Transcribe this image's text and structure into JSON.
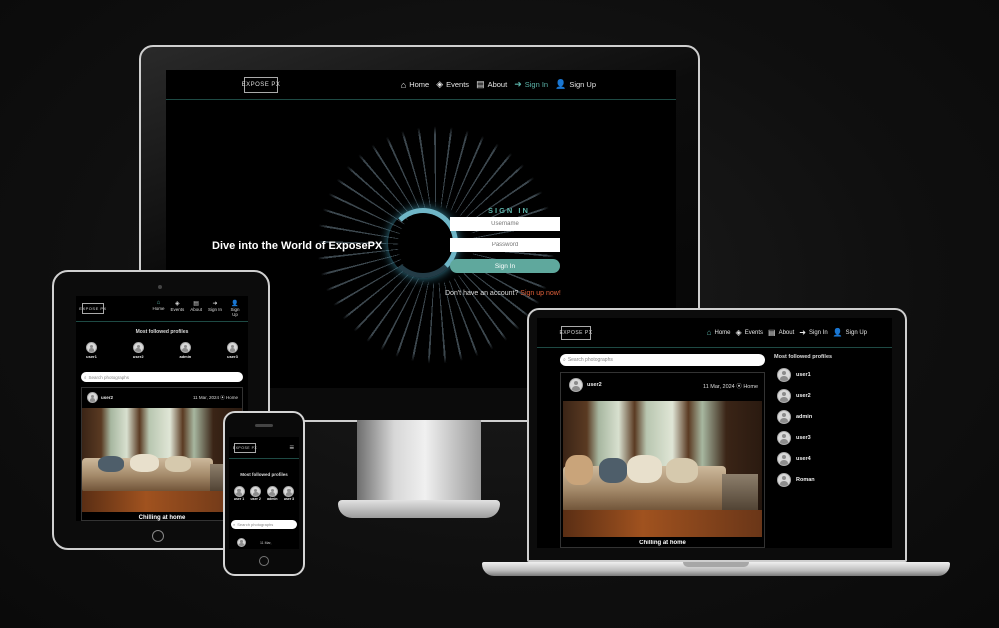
{
  "colors": {
    "accent": "#5bb3a9",
    "signup_link": "#e0603a",
    "background": "#0f0f0f"
  },
  "desktop": {
    "logo": "EXPOSE PX",
    "nav": [
      {
        "label": "Home",
        "icon": "home-icon"
      },
      {
        "label": "Events",
        "icon": "compass-icon"
      },
      {
        "label": "About",
        "icon": "book-icon"
      },
      {
        "label": "Sign In",
        "icon": "sign-in-icon"
      },
      {
        "label": "Sign Up",
        "icon": "user-plus-icon"
      }
    ],
    "hero_title": "Dive into the World of ExposePX",
    "signin": {
      "heading": "SIGN IN",
      "username_placeholder": "Username",
      "password_placeholder": "Password",
      "button": "Sign In",
      "no_account_text": "Don't have an account?",
      "signup_link": "Sign up now!"
    }
  },
  "tablet": {
    "logo": "EXPOSE PX",
    "nav": [
      {
        "label": "Home",
        "icon": "home-icon"
      },
      {
        "label": "Events",
        "icon": "compass-icon"
      },
      {
        "label": "About",
        "icon": "book-icon"
      },
      {
        "label": "Sign In",
        "icon": "sign-in-icon"
      },
      {
        "label": "Sign Up",
        "icon": "user-plus-icon"
      }
    ],
    "most_followed_heading": "Most followed profiles",
    "profiles": [
      "user1",
      "user2",
      "admin",
      "user3"
    ],
    "search_placeholder": "Search photographs",
    "post": {
      "user": "user2",
      "date": "11 Mar, 2024",
      "location": "Home",
      "caption": "Chilling at home"
    }
  },
  "phone": {
    "logo": "EXPOSE PX",
    "menu_icon": "hamburger-icon",
    "most_followed_heading": "Most followed profiles",
    "profiles": [
      "user 1",
      "user 2",
      "admin",
      "user 3"
    ],
    "search_placeholder": "Search photographs",
    "post": {
      "date": "11 Mar,"
    }
  },
  "laptop": {
    "logo": "EXPOSE PX",
    "nav": [
      {
        "label": "Home",
        "icon": "home-icon"
      },
      {
        "label": "Events",
        "icon": "compass-icon"
      },
      {
        "label": "About",
        "icon": "book-icon"
      },
      {
        "label": "Sign In",
        "icon": "sign-in-icon"
      },
      {
        "label": "Sign Up",
        "icon": "user-plus-icon"
      }
    ],
    "search_placeholder": "Search photographs",
    "post": {
      "user": "user2",
      "date": "11 Mar, 2024",
      "location": "Home",
      "caption": "Chilling at home"
    },
    "most_followed_heading": "Most followed profiles",
    "profiles": [
      "user1",
      "user2",
      "admin",
      "user3",
      "user4",
      "Roman"
    ]
  }
}
